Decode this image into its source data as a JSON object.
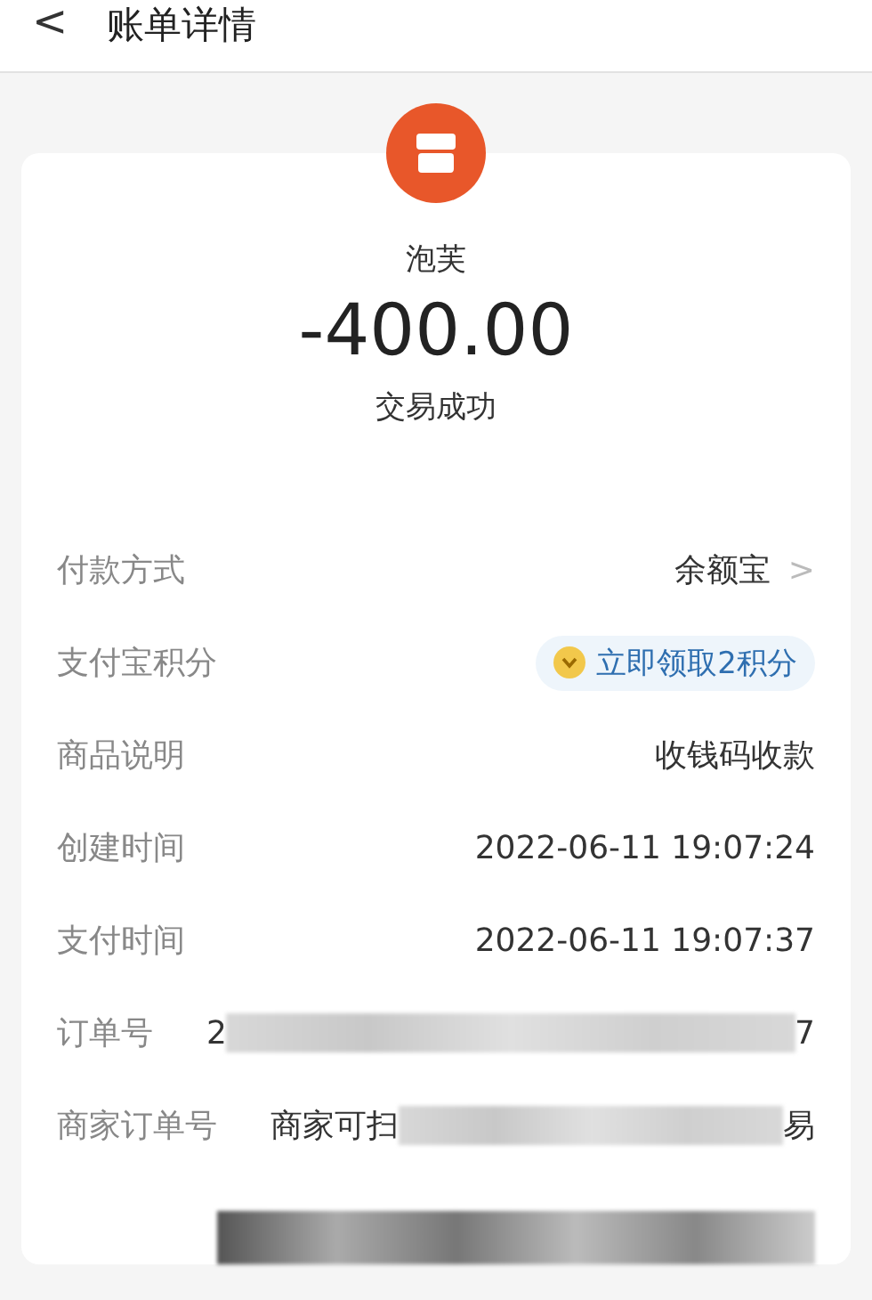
{
  "header": {
    "back": "<",
    "title": "账单详情"
  },
  "merchant": {
    "name": "泡芙",
    "amount": "-400.00",
    "status": "交易成功"
  },
  "rows": [
    {
      "kind": "link",
      "label": "付款方式",
      "value": "余额宝",
      "chevron": ">"
    },
    {
      "kind": "points",
      "label": "支付宝积分",
      "value": "立即领取2积分"
    },
    {
      "kind": "text",
      "label": "商品说明",
      "value": "收钱码收款"
    },
    {
      "kind": "text",
      "label": "创建时间",
      "value": "2022-06-11 19:07:24"
    },
    {
      "kind": "text",
      "label": "支付时间",
      "value": "2022-06-11 19:07:37"
    },
    {
      "kind": "redacted",
      "label": "订单号",
      "value": "2",
      "value_end": "7"
    },
    {
      "kind": "redacted",
      "label": "商家订单号",
      "value": "商家可扫",
      "value_end": "易"
    }
  ]
}
